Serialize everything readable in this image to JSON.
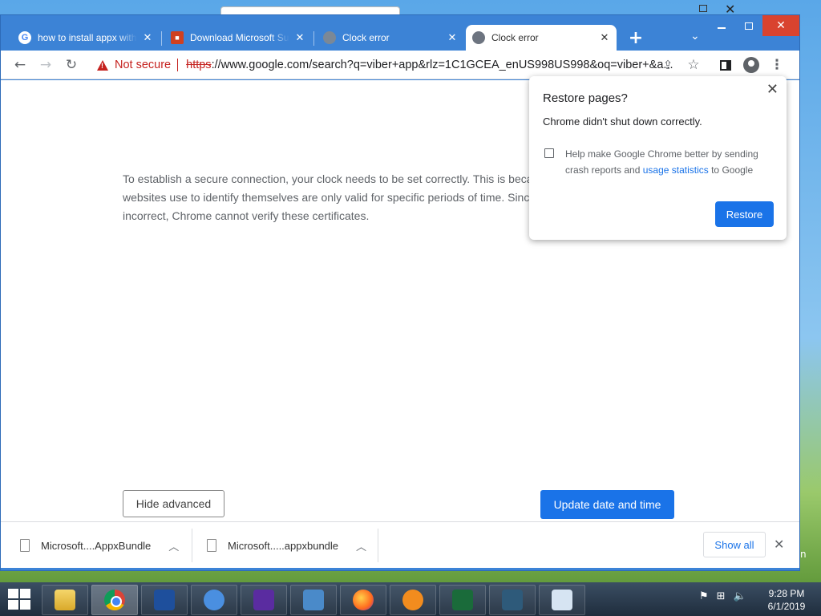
{
  "tabs": [
    {
      "title": "how to install appx with",
      "favicon": "google-icon"
    },
    {
      "title": "Download Microsoft Su",
      "favicon": "microsoft-store-icon"
    },
    {
      "title": "Clock error",
      "favicon": "globe-icon"
    },
    {
      "title": "Clock error",
      "favicon": "globe-icon",
      "active": true
    }
  ],
  "toolbar": {
    "security_label": "Not secure",
    "url_scheme": "https",
    "url_rest": "://www.google.com/search?q=viber+app&rlz=1C1GCEA_enUS998US998&oq=viber+&a..."
  },
  "page": {
    "paragraph_lines": [
      "To establish a secure connection, your clock needs to be set correctly. This is beca",
      "websites use to identify themselves are only valid for specific periods of time. Sinc",
      "incorrect, Chrome cannot verify these certificates."
    ],
    "hide_advanced_label": "Hide advanced",
    "update_label": "Update date and time"
  },
  "restore_popup": {
    "title": "Restore pages?",
    "message": "Chrome didn't shut down correctly.",
    "help_prefix": "Help make Google Chrome better by sending crash reports and ",
    "help_link": "usage statistics",
    "help_suffix": " to Google",
    "restore_label": "Restore"
  },
  "downloads": {
    "items": [
      {
        "name": "Microsoft....AppxBundle"
      },
      {
        "name": "Microsoft.....appxbundle"
      }
    ],
    "show_all_label": "Show all"
  },
  "desktop": {
    "edge_text": "n"
  },
  "taskbar": {
    "time": "9:28 PM",
    "date": "6/1/2019"
  },
  "colors": {
    "accent": "#1a73e8",
    "warning": "#c5221f",
    "tabstrip": "#3c83d6"
  }
}
